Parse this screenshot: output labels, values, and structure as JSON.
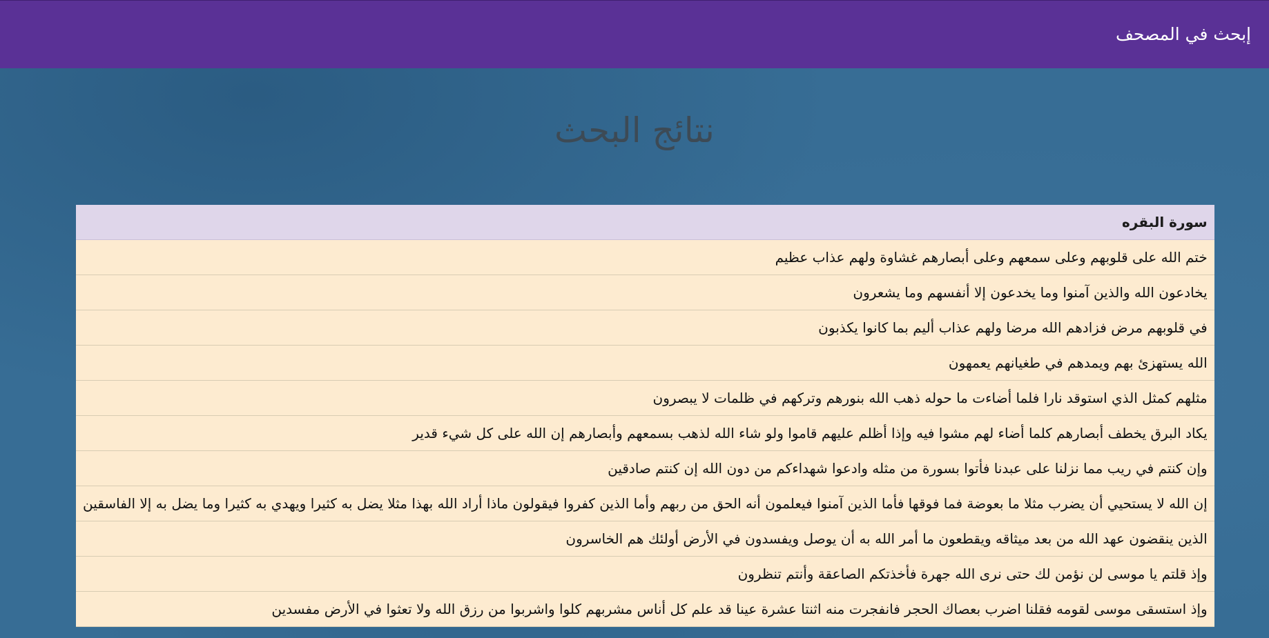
{
  "navbar": {
    "brand": "إبحث في المصحف"
  },
  "page": {
    "title": "نتائج البحث"
  },
  "results": {
    "surah_header": "سورة البقره",
    "verses": [
      "ختم الله على قلوبهم وعلى سمعهم وعلى أبصارهم غشاوة ولهم عذاب عظيم",
      "يخادعون الله والذين آمنوا وما يخدعون إلا أنفسهم وما يشعرون",
      "في قلوبهم مرض فزادهم الله مرضا ولهم عذاب أليم بما كانوا يكذبون",
      "الله يستهزئ بهم ويمدهم في طغيانهم يعمهون",
      "مثلهم كمثل الذي استوقد نارا فلما أضاءت ما حوله ذهب الله بنورهم وتركهم في ظلمات لا يبصرون",
      "يكاد البرق يخطف أبصارهم كلما أضاء لهم مشوا فيه وإذا أظلم عليهم قاموا ولو شاء الله لذهب بسمعهم وأبصارهم إن الله على كل شيء قدير",
      "وإن كنتم في ريب مما نزلنا على عبدنا فأتوا بسورة من مثله وادعوا شهداءكم من دون الله إن كنتم صادقين",
      "إن الله لا يستحيي أن يضرب مثلا ما بعوضة فما فوقها فأما الذين آمنوا فيعلمون أنه الحق من ربهم وأما الذين كفروا فيقولون ماذا أراد الله بهذا مثلا يضل به كثيرا ويهدي به كثيرا وما يضل به إلا الفاسقين",
      "الذين ينقضون عهد الله من بعد ميثاقه ويقطعون ما أمر الله به أن يوصل ويفسدون في الأرض أولئك هم الخاسرون",
      "وإذ قلتم يا موسى لن نؤمن لك حتى نرى الله جهرة فأخذتكم الصاعقة وأنتم تنظرون",
      "وإذ استسقى موسى لقومه فقلنا اضرب بعصاك الحجر فانفجرت منه اثنتا عشرة عينا قد علم كل أناس مشربهم كلوا واشربوا من رزق الله ولا تعثوا في الأرض مفسدين"
    ]
  }
}
